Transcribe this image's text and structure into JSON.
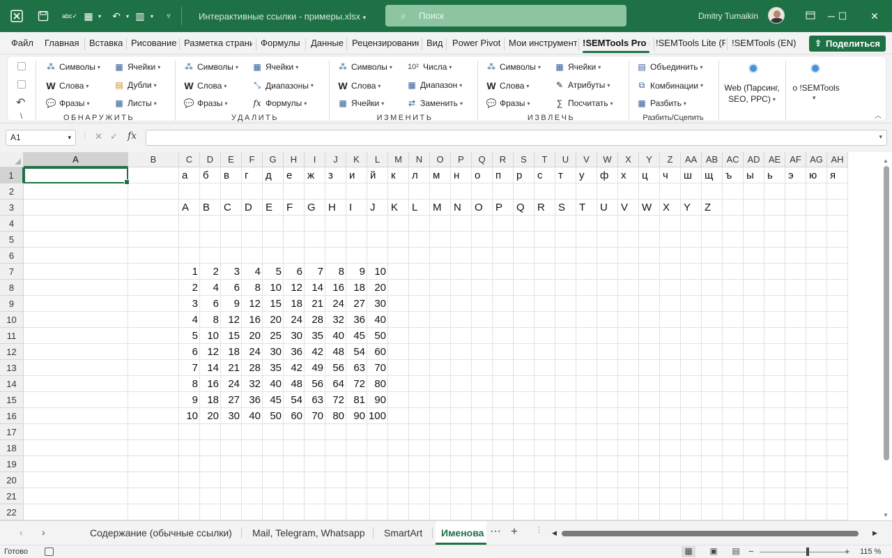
{
  "window": {
    "title": "Интерактивные ссылки - примеры.xlsx",
    "search_placeholder": "Поиск",
    "user_name": "Dmitry Tumaikin",
    "accent_color": "#1e7145"
  },
  "menu": {
    "tabs": [
      "Файл",
      "Главная",
      "Вставка",
      "Рисование",
      "Разметка страни",
      "Формулы",
      "Данные",
      "Рецензирование",
      "Вид",
      "Power Pivot",
      "Мои инструмент",
      "!SEMTools Pro (",
      "!SEMTools Lite (F",
      "!SEMTools (EN)"
    ],
    "active_tab": "!SEMTools Pro (",
    "share_label": "Поделиться"
  },
  "ribbon": {
    "detect": {
      "label": "ОБНАРУЖИТЬ",
      "items": [
        "Символы",
        "Слова",
        "Фразы",
        "Ячейки",
        "Дубли",
        "Листы"
      ]
    },
    "remove": {
      "label": "УДАЛИТЬ",
      "items": [
        "Символы",
        "Слова",
        "Фразы",
        "Ячейки",
        "Диапазоны",
        "Формулы"
      ]
    },
    "change": {
      "label": "ИЗМЕНИТЬ",
      "items": [
        "Символы",
        "Слова",
        "Ячейки",
        "Числа",
        "Диапазон",
        "Заменить"
      ]
    },
    "extract": {
      "label": "ИЗВЛЕЧЬ",
      "items": [
        "Символы",
        "Слова",
        "Фразы",
        "Ячейки",
        "Атрибуты",
        "Посчитать"
      ]
    },
    "split": {
      "label": "Разбить/Сцепить",
      "items": [
        "Объединить",
        "Комбинации",
        "Разбить"
      ]
    },
    "web": {
      "line1": "Web (Парсинг,",
      "line2": "SEO, PPC)"
    },
    "about": {
      "label": "о !SEMTools"
    },
    "undo_under": "\\"
  },
  "formula_bar": {
    "name_box": "A1",
    "fx_label": "fx",
    "value": ""
  },
  "grid": {
    "columns": [
      "A",
      "B",
      "C",
      "D",
      "E",
      "F",
      "G",
      "H",
      "I",
      "J",
      "K",
      "L",
      "M",
      "N",
      "O",
      "P",
      "Q",
      "R",
      "S",
      "T",
      "U",
      "V",
      "W",
      "X",
      "Y",
      "Z",
      "AA",
      "AB",
      "AC",
      "AD",
      "AE",
      "AF",
      "AG",
      "AH"
    ],
    "rows": [
      1,
      2,
      3,
      4,
      5,
      6,
      7,
      8,
      9,
      10,
      11,
      12,
      13,
      14,
      15,
      16,
      17,
      18,
      19,
      20,
      21,
      22
    ],
    "selected_cell": "A1",
    "row1_cyrillic": [
      "а",
      "б",
      "в",
      "г",
      "д",
      "е",
      "ж",
      "з",
      "и",
      "й",
      "к",
      "л",
      "м",
      "н",
      "о",
      "п",
      "р",
      "с",
      "т",
      "у",
      "ф",
      "х",
      "ц",
      "ч",
      "ш",
      "щ",
      "ъ",
      "ы",
      "ь",
      "э",
      "ю",
      "я"
    ],
    "row3_latin": [
      "A",
      "B",
      "C",
      "D",
      "E",
      "F",
      "G",
      "H",
      "I",
      "J",
      "K",
      "L",
      "M",
      "N",
      "O",
      "P",
      "Q",
      "R",
      "S",
      "T",
      "U",
      "V",
      "W",
      "X",
      "Y",
      "Z"
    ],
    "multiplication_table": [
      [
        1,
        2,
        3,
        4,
        5,
        6,
        7,
        8,
        9,
        10
      ],
      [
        2,
        4,
        6,
        8,
        10,
        12,
        14,
        16,
        18,
        20
      ],
      [
        3,
        6,
        9,
        12,
        15,
        18,
        21,
        24,
        27,
        30
      ],
      [
        4,
        8,
        12,
        16,
        20,
        24,
        28,
        32,
        36,
        40
      ],
      [
        5,
        10,
        15,
        20,
        25,
        30,
        35,
        40,
        45,
        50
      ],
      [
        6,
        12,
        18,
        24,
        30,
        36,
        42,
        48,
        54,
        60
      ],
      [
        7,
        14,
        21,
        28,
        35,
        42,
        49,
        56,
        63,
        70
      ],
      [
        8,
        16,
        24,
        32,
        40,
        48,
        56,
        64,
        72,
        80
      ],
      [
        9,
        18,
        27,
        36,
        45,
        54,
        63,
        72,
        81,
        90
      ],
      [
        10,
        20,
        30,
        40,
        50,
        60,
        70,
        80,
        90,
        100
      ]
    ]
  },
  "sheets": {
    "tabs": [
      "Содержание (обычные ссылки)",
      "Mail, Telegram, Whatsapp",
      "SmartArt",
      "Именова"
    ],
    "active": "Именова",
    "more": "···",
    "add": "+"
  },
  "status": {
    "text": "Готово",
    "zoom": "115 %"
  }
}
